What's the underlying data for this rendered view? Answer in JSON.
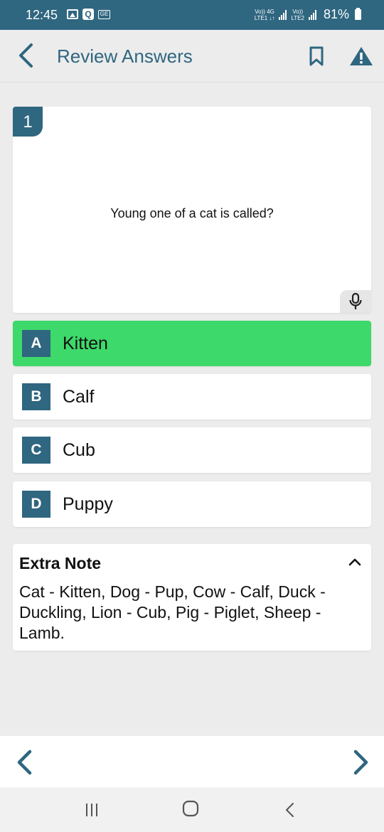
{
  "status_bar": {
    "time": "12:45",
    "net1_top": "Vo)) 4G",
    "net1_bottom": "LTE1 ↓↑",
    "net2_top": "Vo))",
    "net2_bottom": "LTE2",
    "battery": "81%",
    "notification_icons": [
      "gallery-icon",
      "q-app-icon",
      "ge-icon"
    ]
  },
  "header": {
    "title": "Review Answers",
    "icons": [
      "back-arrow-icon",
      "bookmark-icon",
      "warning-icon"
    ]
  },
  "question": {
    "number": "1",
    "text": "Young one of a cat is called?",
    "mic_icon": "microphone-icon"
  },
  "options": [
    {
      "letter": "A",
      "text": "Kitten",
      "correct": true
    },
    {
      "letter": "B",
      "text": "Calf",
      "correct": false
    },
    {
      "letter": "C",
      "text": "Cub",
      "correct": false
    },
    {
      "letter": "D",
      "text": "Puppy",
      "correct": false
    }
  ],
  "extra_note": {
    "title": "Extra Note",
    "text": "Cat - Kitten, Dog - Pup, Cow - Calf, Duck - Duckling, Lion - Cub, Pig - Piglet, Sheep - Lamb.",
    "expanded": true
  },
  "colors": {
    "primary": "#2f6680",
    "correct": "#3dd96a",
    "background": "#ececec"
  }
}
